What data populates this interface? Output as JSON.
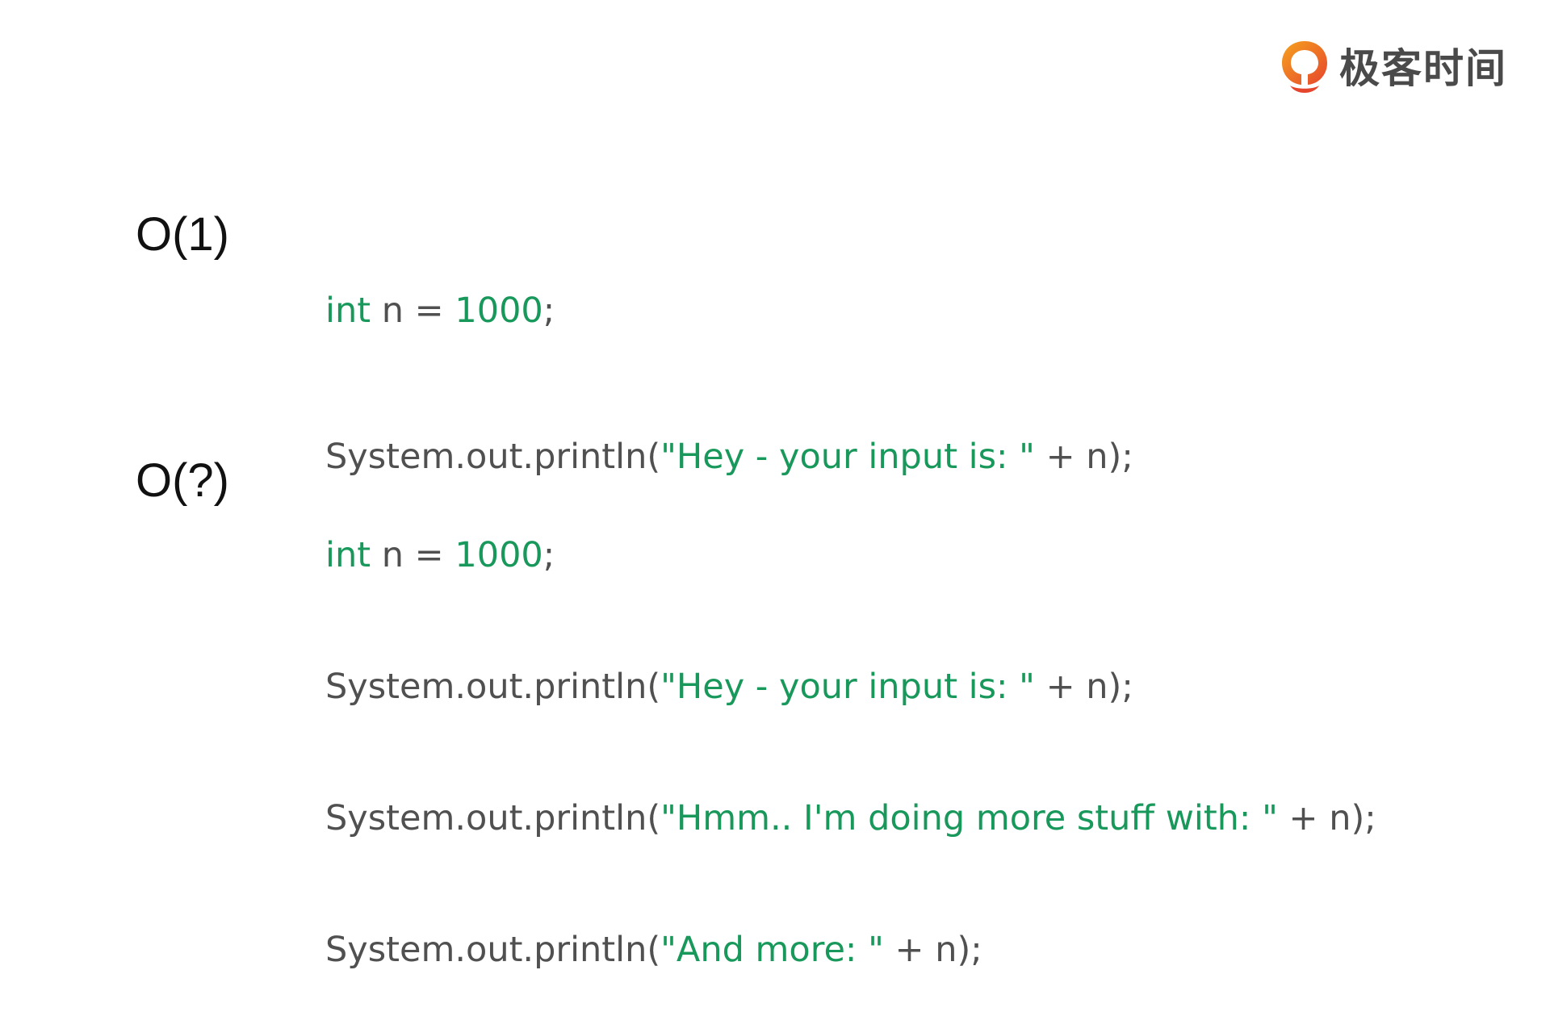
{
  "brand": {
    "name": "极客时间",
    "logo_icon": "geektime-logo-icon",
    "colors": {
      "orange": "#f08a1d",
      "red": "#e6452d",
      "text": "#4a4a4a"
    }
  },
  "colors": {
    "code_text": "#505050",
    "highlight": "#18985a",
    "label": "#111111"
  },
  "sections": [
    {
      "label": "O(1)",
      "lines": [
        [
          {
            "text": "int",
            "style": "kw"
          },
          {
            "text": " n = ",
            "style": "plain"
          },
          {
            "text": "1000",
            "style": "num"
          },
          {
            "text": ";",
            "style": "plain"
          }
        ],
        [
          {
            "text": "System.out.println(",
            "style": "plain"
          },
          {
            "text": "\"Hey - your input is: \"",
            "style": "str"
          },
          {
            "text": " + n);",
            "style": "plain"
          }
        ]
      ]
    },
    {
      "label": "O(?)",
      "lines": [
        [
          {
            "text": "int",
            "style": "kw"
          },
          {
            "text": " n = ",
            "style": "plain"
          },
          {
            "text": "1000",
            "style": "num"
          },
          {
            "text": ";",
            "style": "plain"
          }
        ],
        [
          {
            "text": "System.out.println(",
            "style": "plain"
          },
          {
            "text": "\"Hey - your input is: \"",
            "style": "str"
          },
          {
            "text": " + n);",
            "style": "plain"
          }
        ],
        [
          {
            "text": "System.out.println(",
            "style": "plain"
          },
          {
            "text": "\"Hmm.. I'm doing more stuff with: \"",
            "style": "str"
          },
          {
            "text": " + n);",
            "style": "plain"
          }
        ],
        [
          {
            "text": "System.out.println(",
            "style": "plain"
          },
          {
            "text": "\"And more: \"",
            "style": "str"
          },
          {
            "text": " + n);",
            "style": "plain"
          }
        ]
      ]
    }
  ]
}
